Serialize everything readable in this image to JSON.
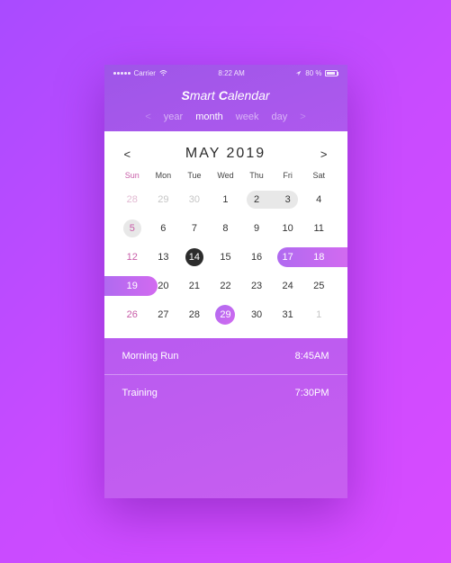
{
  "status": {
    "carrier": "Carrier",
    "wifi": "wifi",
    "time": "8:22 AM",
    "loc": "loc",
    "battery": "80 %"
  },
  "app": {
    "title_a": "S",
    "title_b": "mart ",
    "title_c": "C",
    "title_d": "alendar"
  },
  "tabs": {
    "prev": "<",
    "next": ">",
    "year": "year",
    "month": "month",
    "week": "week",
    "day": "day"
  },
  "month": {
    "prev": "<",
    "title": "MAY 2019",
    "next": ">"
  },
  "dow": [
    "Sun",
    "Mon",
    "Tue",
    "Wed",
    "Thu",
    "Fri",
    "Sat"
  ],
  "rows": [
    [
      "28",
      "29",
      "30",
      "1",
      "2",
      "3",
      "4"
    ],
    [
      "5",
      "6",
      "7",
      "8",
      "9",
      "10",
      "11"
    ],
    [
      "12",
      "13",
      "14",
      "15",
      "16",
      "17",
      "18"
    ],
    [
      "19",
      "20",
      "21",
      "22",
      "23",
      "24",
      "25"
    ],
    [
      "26",
      "27",
      "28",
      "29",
      "30",
      "31",
      "1"
    ]
  ],
  "events": [
    {
      "name": "Morning Run",
      "time": "8:45AM"
    },
    {
      "name": "Training",
      "time": "7:30PM"
    }
  ]
}
